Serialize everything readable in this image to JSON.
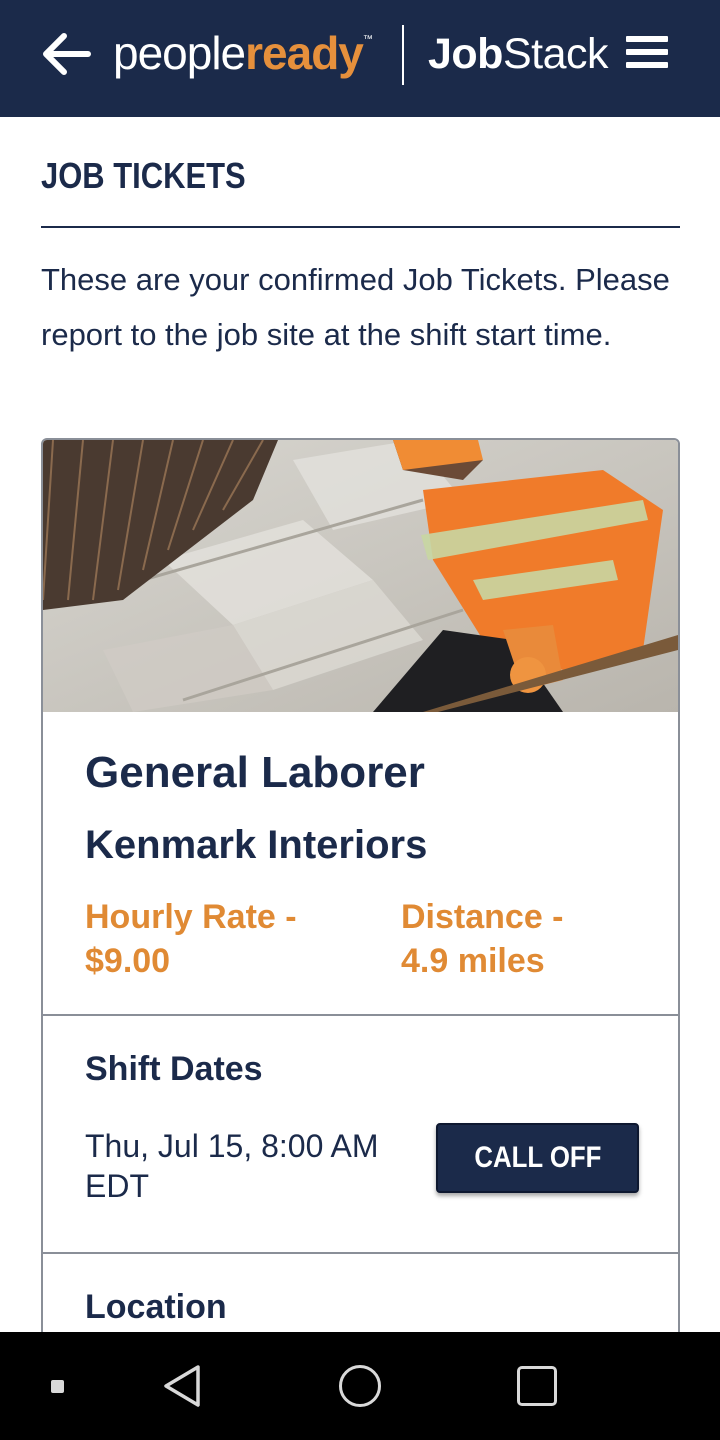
{
  "header": {
    "back_icon": "arrow-left-icon",
    "logo_people": "people",
    "logo_ready": "ready",
    "logo_tm": "™",
    "logo_job": "Job",
    "logo_stack": "Stack",
    "menu_icon": "hamburger-menu-icon",
    "background_color": "#1b2a4a",
    "accent_color": "#e6903c"
  },
  "page": {
    "title": "JOB TICKETS",
    "intro": "These are your confirmed Job Tickets. Please report to the job site at the shift start time."
  },
  "ticket": {
    "image_description_icon": "worker-photo",
    "job_title": "General Laborer",
    "company": "Kenmark Interiors",
    "rate_label": "Hourly Rate -",
    "rate_value": "$9.00",
    "distance_label": "Distance -",
    "distance_value": "4.9 miles",
    "shift_heading": "Shift Dates",
    "shift_line1": "Thu, Jul 15, 8:00 AM",
    "shift_line2": "EDT",
    "call_off_label": "CALL OFF",
    "location_heading": "Location"
  },
  "system_nav": {
    "items": [
      "recents-dot-icon",
      "back-triangle-icon",
      "home-circle-icon",
      "overview-square-icon"
    ]
  }
}
